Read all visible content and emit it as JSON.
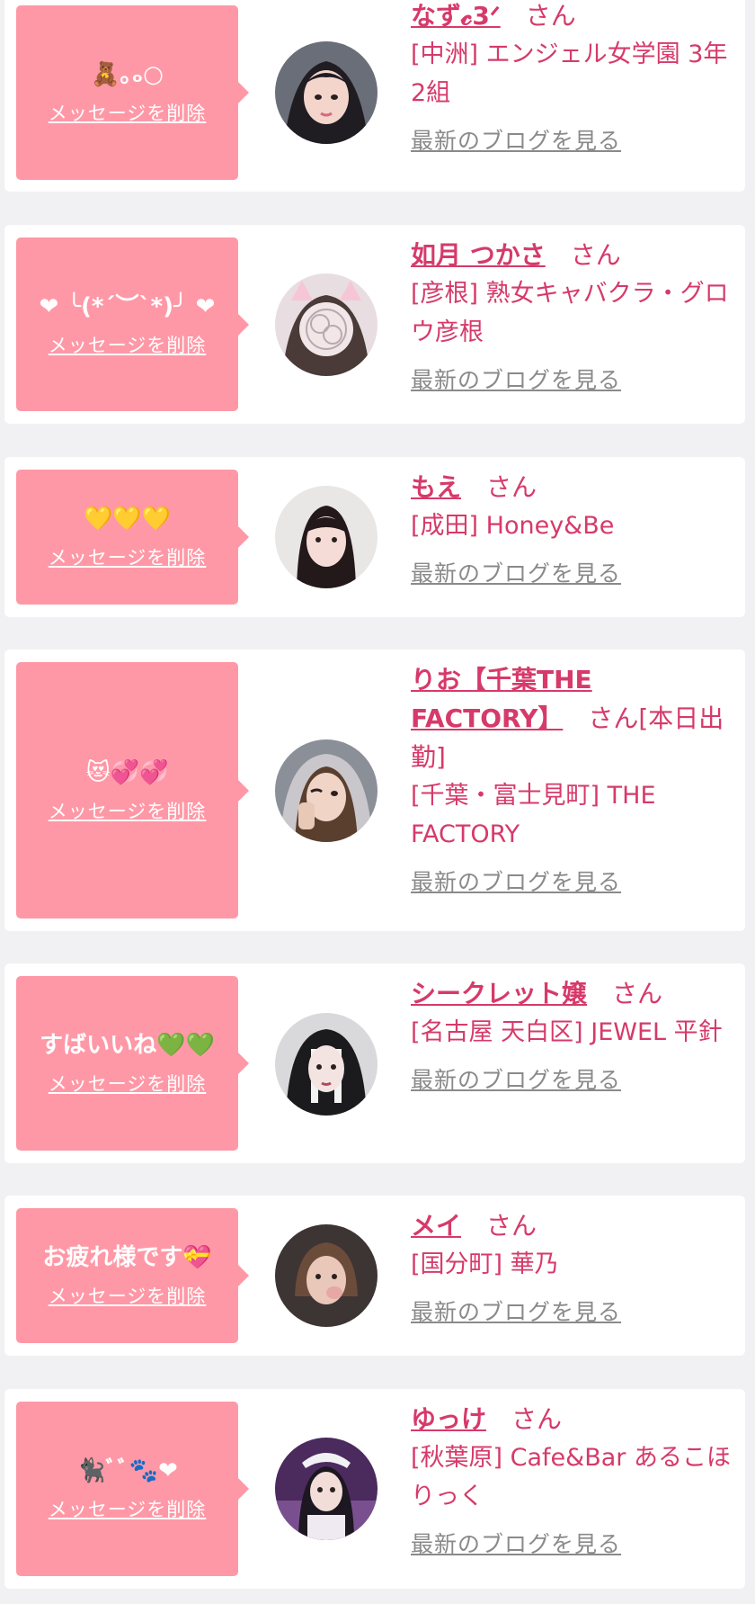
{
  "delete_label": "メッセージを削除",
  "blog_label": "最新のブログを見る",
  "san_label": "さん",
  "colors": {
    "bubble": "#ff98a6",
    "accent": "#d63a6a",
    "link_gray": "#8a8a8a",
    "background": "#f1f1f3"
  },
  "messages": [
    {
      "message": "🧸｡ₒ○",
      "name": "なず𝓬3ᐟ",
      "suffix": "",
      "shop": "[中洲] エンジェル女学園 3年2組",
      "avatar_icon": "girl-photo"
    },
    {
      "message": "❤ ╰(*´︶`*)╯ ❤",
      "name": "如月 つかさ",
      "suffix": "",
      "shop": "[彦根] 熟女キャバクラ・グロウ彦根",
      "avatar_icon": "blurred-photo"
    },
    {
      "message": "💛💛💛",
      "name": "もえ",
      "suffix": "",
      "shop": "[成田] Honey&Be",
      "avatar_icon": "girl-photo"
    },
    {
      "message": "😻💞💞",
      "name": "りお【千葉THE FACTORY】",
      "suffix": "[本日出勤]",
      "shop": "[千葉・富士見町] THE FACTORY",
      "avatar_icon": "girl-photo"
    },
    {
      "message": "すばいいね💚💚",
      "name": "シークレット嬢",
      "suffix": "",
      "shop": "[名古屋 天白区] JEWEL 平針",
      "avatar_icon": "girl-photo"
    },
    {
      "message": "お疲れ様です💝",
      "name": "メイ",
      "suffix": "",
      "shop": "[国分町] 華乃",
      "avatar_icon": "girl-photo"
    },
    {
      "message": "🐈‍⬛ﾞﾞ🐾❤",
      "name": "ゆっけ",
      "suffix": "",
      "shop": "[秋葉原] Cafe&Bar あるこほりっく",
      "avatar_icon": "girl-photo"
    }
  ]
}
